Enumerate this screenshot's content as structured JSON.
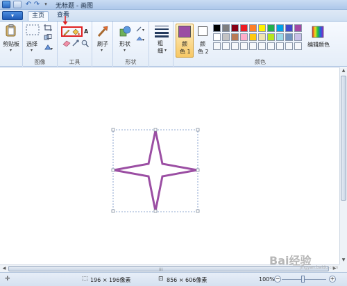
{
  "window": {
    "title": "无标题 - 画图"
  },
  "tabs": {
    "file": "▾",
    "home": "主页",
    "view": "查看"
  },
  "ribbon": {
    "clipboard": {
      "paste_label": "剪贴板"
    },
    "image": {
      "select_label": "选择",
      "group_label": "图像"
    },
    "tools": {
      "group_label": "工具",
      "text_tool": "A"
    },
    "brushes": {
      "label": "刷子"
    },
    "shapes": {
      "shapes_label": "形状",
      "group_label": "形状"
    },
    "size": {
      "label_line1": "粗",
      "label_line2": "细"
    },
    "colors": {
      "color1_line1": "颜",
      "color1_line2": "色 1",
      "color2_line1": "颜",
      "color2_line2": "色 2",
      "edit_label": "编辑颜色",
      "group_label": "颜色",
      "color1_value": "#9b4ea3",
      "color2_value": "#ffffff",
      "palette_row1": [
        "#000000",
        "#7f7f7f",
        "#880015",
        "#ed1c24",
        "#ff7f27",
        "#fff200",
        "#22b14c",
        "#00a2e8",
        "#3f48cc",
        "#a349a4"
      ],
      "palette_row2": [
        "#ffffff",
        "#c3c3c3",
        "#b97a57",
        "#ffaec9",
        "#ffc90e",
        "#efe4b0",
        "#b5e61d",
        "#99d9ea",
        "#7092be",
        "#c8bfe7"
      ]
    }
  },
  "accent": {
    "highlight": "#e02020",
    "star_stroke": "#9b4ea3"
  },
  "status": {
    "selection_size": "196 × 196像素",
    "canvas_size": "856 × 606像素",
    "zoom": "100%",
    "zoom_out": "−",
    "zoom_in": "+"
  },
  "watermark": {
    "text": "Bai经验",
    "sub": "jingyan.baidu.com"
  }
}
